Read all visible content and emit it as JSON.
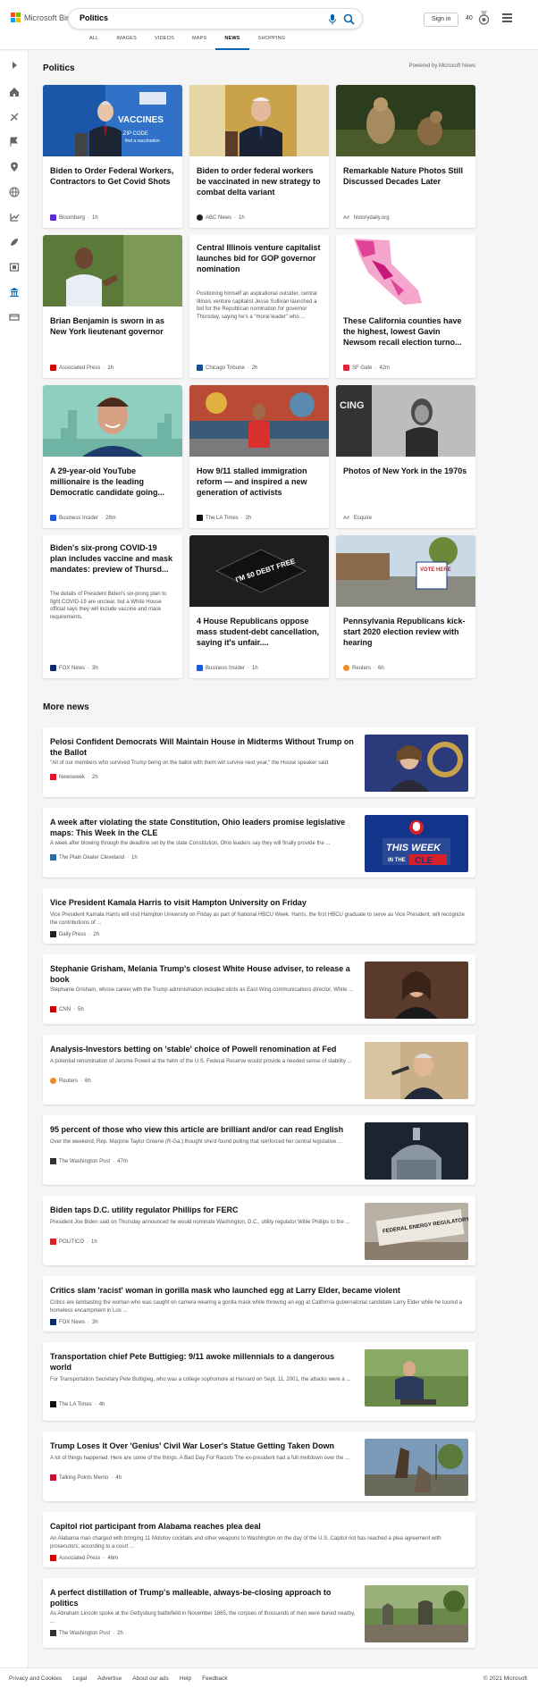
{
  "header": {
    "brand": "Microsoft Bing",
    "search_value": "Politics",
    "signin_label": "Sign in",
    "points": "40",
    "tabs": [
      "ALL",
      "IMAGES",
      "VIDEOS",
      "MAPS",
      "NEWS",
      "SHOPPING"
    ],
    "active_tab": "NEWS"
  },
  "section": {
    "title": "Politics",
    "powered": "Powered by Microsoft News"
  },
  "cards": [
    {
      "title": "Biden to Order Federal Workers, Contractors to Get Covid Shots",
      "source": "Bloomberg",
      "time": "1h",
      "src_color": "#5a2bd6"
    },
    {
      "title": "Biden to order federal workers be vaccinated in new strategy to combat delta variant",
      "source": "ABC News",
      "time": "1h",
      "src_color": "#222222"
    },
    {
      "title": "Remarkable Nature Photos Still Discussed Decades Later",
      "source": "historydaily.org",
      "ad": "Ad"
    },
    {
      "title": "Brian Benjamin is sworn in as New York lieutenant governor",
      "source": "Associated Press",
      "time": "1h",
      "src_color": "#d40000"
    },
    {
      "title": "Central Illinois venture capitalist launches bid for GOP governor nomination",
      "summary": "Positioning himself an aspirational outsider, central Illinois venture capitalist Jesse Sullivan launched a bid for the Republican nomination for governor Thursday, saying he's a \"moral leader\" who ...",
      "source": "Chicago Tribune",
      "time": "2h",
      "src_color": "#1a4f8b"
    },
    {
      "title": "These California counties have the highest, lowest Gavin Newsom recall election turno...",
      "source": "SF Gate",
      "time": "42m",
      "src_color": "#e0263c"
    },
    {
      "title": "A 29-year-old YouTube millionaire is the leading Democratic candidate going...",
      "source": "Business Insider",
      "time": "28m",
      "src_color": "#1f5bd8"
    },
    {
      "title": "How 9/11 stalled immigration reform — and inspired a new generation of activists",
      "source": "The LA Times",
      "time": "2h",
      "src_color": "#111111"
    },
    {
      "title": "Photos of New York in the 1970s",
      "source": "Esquire",
      "ad": "Ad"
    },
    {
      "title": "Biden's six-prong COVID-19 plan includes vaccine and mask mandates: preview of Thursd...",
      "summary": "The details of President Biden's six-prong plan to fight COVID-19 are unclear, but a White House official says they will include vaccine and mask requirements.",
      "source": "FOX News",
      "time": "3h",
      "src_color": "#0b2a6b"
    },
    {
      "title": "4 House Republicans oppose mass student-debt cancellation, saying it's unfair....",
      "source": "Business Insider",
      "time": "1h",
      "src_color": "#1f5bd8"
    },
    {
      "title": "Pennsylvania Republicans kick-start 2020 election review with hearing",
      "source": "Reuters",
      "time": "6h",
      "src_color": "#f08a24"
    }
  ],
  "more": {
    "title": "More news",
    "items": [
      {
        "title": "Pelosi Confident Democrats Will Maintain House in Midterms Without Trump on the Ballot",
        "summary": "\"All of our members who survived Trump being on the ballot with them will survive next year,\" the House speaker said.",
        "source": "Newsweek",
        "time": "2h",
        "src_color": "#e3122b"
      },
      {
        "title": "A week after violating the state Constitution, Ohio leaders promise legislative maps: This Week in the CLE",
        "summary": "A week after blowing through the deadline set by the state Constitution, Ohio leaders say they will finally provide the ...",
        "source": "The Plain Dealer Cleveland",
        "time": "1h",
        "src_color": "#2c6aa0"
      },
      {
        "title": "Vice President Kamala Harris to visit Hampton University on Friday",
        "summary": "Vice President Kamala Harris will visit Hampton University on Friday as part of National HBCU Week. Harris, the first HBCU graduate to serve as Vice President, will recognize the contributions of ...",
        "source": "Daily Press",
        "time": "2h",
        "src_color": "#222222"
      },
      {
        "title": "Stephanie Grisham, Melania Trump's closest White House adviser, to release a book",
        "summary": "Stephanie Grisham, whose career with the Trump administration included stints as East Wing communications director, White ...",
        "source": "CNN",
        "time": "5h",
        "src_color": "#cc0000"
      },
      {
        "title": "Analysis-Investors betting on 'stable' choice of Powell renomination at Fed",
        "summary": "A potential renomination of Jerome Powell at the helm of the U.S. Federal Reserve would provide a needed sense of stability ...",
        "source": "Reuters",
        "time": "6h",
        "src_color": "#f08a24"
      },
      {
        "title": "95 percent of those who view this article are brilliant and/or can read English",
        "summary": "Over the weekend, Rep. Marjorie Taylor Greene (R-Ga.) thought she'd found polling that reinforced her central legislative ...",
        "source": "The Washington Post",
        "time": "47m",
        "src_color": "#333333"
      },
      {
        "title": "Biden taps D.C. utility regulator Phillips for FERC",
        "summary": "President Joe Biden said on Thursday announced he would nominate Washington, D.C., utility regulator Willie Phillips to the ...",
        "source": "POLITICO",
        "time": "1h",
        "src_color": "#d8232a"
      },
      {
        "title": "Critics slam 'racist' woman in gorilla mask who launched egg at Larry Elder, became violent",
        "summary": "Critics are lambasting the woman who was caught on camera wearing a gorilla mask while throwing an egg at California gubernatorial candidate Larry Elder while he toured a homeless encampment in Los ...",
        "source": "FOX News",
        "time": "3h",
        "src_color": "#0b2a6b"
      },
      {
        "title": "Transportation chief Pete Buttigieg: 9/11 awoke millennials to a dangerous world",
        "summary": "For Transportation Secretary Pete Buttigieg, who was a college sophomore at Harvard on Sept. 11, 2001, the attacks were a ...",
        "source": "The LA Times",
        "time": "4h",
        "src_color": "#111111"
      },
      {
        "title": "Trump Loses It Over 'Genius' Civil War Loser's Statue Getting Taken Down",
        "summary": "A lot of things happened. Here are some of the things. A Bad Day For Racists The ex-president had a full meltdown over the ...",
        "source": "Talking Points Memo",
        "time": "4h",
        "src_color": "#c8102e"
      },
      {
        "title": "Capitol riot participant from Alabama reaches plea deal",
        "summary": "An Alabama man charged with bringing 11 Molotov cocktails and other weapons to Washington on the day of the U.S. Capitol riot has reached a plea agreement with prosecutors, according to a court ...",
        "source": "Associated Press",
        "time": "46m",
        "src_color": "#d40000"
      },
      {
        "title": "A perfect distillation of Trump's malleable, always-be-closing approach to politics",
        "summary": "As Abraham Lincoln spoke at the Gettysburg battlefield in November 1865, the corpses of thousands of men were buried nearby, ...",
        "source": "The Washington Post",
        "time": "2h",
        "src_color": "#333333"
      }
    ]
  },
  "image_texts": {
    "vaccines": "VACCINES",
    "zip": "r ZIP CODE",
    "find": "find a vaccination",
    "vote_here": "VOTE HERE",
    "this_week": "THIS WEEK",
    "in_the": "IN THE",
    "cle": "CLE",
    "ferc": "FEDERAL ENERGY REGULATORY COMMISSION",
    "cing": "CING",
    "debt": "I'M $0 DEBT FREE"
  },
  "footer": {
    "links": [
      "Privacy and Cookies",
      "Legal",
      "Advertise",
      "About our ads",
      "Help",
      "Feedback"
    ],
    "copyright": "© 2021 Microsoft"
  }
}
